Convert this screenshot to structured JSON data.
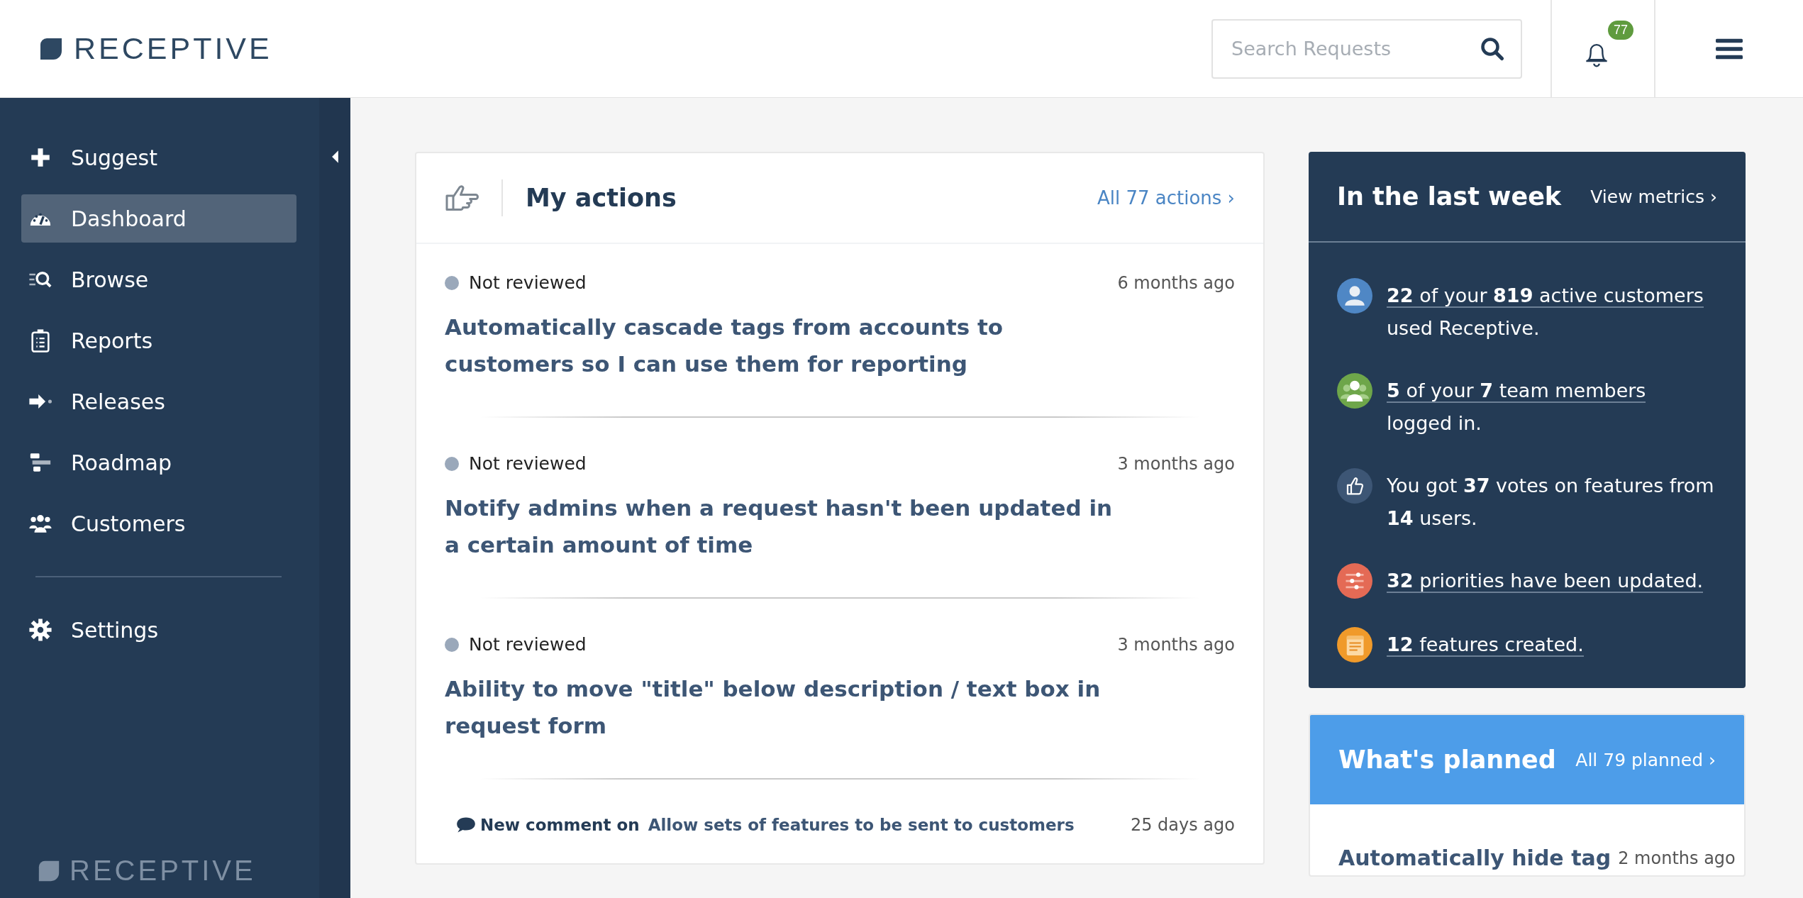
{
  "header": {
    "logo": "RECEPTIVE",
    "search": {
      "placeholder": "Search Requests"
    },
    "notifications": {
      "count": "77"
    }
  },
  "sidebar": {
    "items": [
      {
        "label": "Suggest",
        "selected": false
      },
      {
        "label": "Dashboard",
        "selected": true
      },
      {
        "label": "Browse",
        "selected": false
      },
      {
        "label": "Reports",
        "selected": false
      },
      {
        "label": "Releases",
        "selected": false
      },
      {
        "label": "Roadmap",
        "selected": false
      },
      {
        "label": "Customers",
        "selected": false
      }
    ],
    "bottom_items": [
      {
        "label": "Settings",
        "selected": false
      }
    ],
    "footer_logo": "RECEPTIVE"
  },
  "my_actions": {
    "title": "My actions",
    "link": "All 77 actions ›",
    "items": [
      {
        "kind": "request",
        "status": "Not reviewed",
        "time": "6 months ago",
        "title": "Automatically cascade tags from accounts to customers so I can use them for reporting"
      },
      {
        "kind": "request",
        "status": "Not reviewed",
        "time": "3 months ago",
        "title": "Notify admins when a request hasn't been updated in a certain amount of time"
      },
      {
        "kind": "request",
        "status": "Not reviewed",
        "time": "3 months ago",
        "title": "Ability to move \"title\" below description / text box in request form"
      },
      {
        "kind": "comment",
        "prefix": "New comment on",
        "link": "Allow sets of features to be sent to customers",
        "time": "25 days ago"
      }
    ]
  },
  "last_week": {
    "title": "In the last week",
    "link": "View metrics ›",
    "items": [
      {
        "kind": "customers",
        "link": "**22** of your **819** active customers",
        "text": "used Receptive."
      },
      {
        "kind": "team",
        "link": "**5** of your **7** team members",
        "text": "logged in."
      },
      {
        "kind": "votes",
        "text": "You got **37** votes on features from **14** users."
      },
      {
        "kind": "priorities",
        "link": "**32** priorities have been updated."
      },
      {
        "kind": "features",
        "link": "**12** features created."
      }
    ]
  },
  "planned": {
    "title": "What's planned",
    "link": "All 79 planned ›",
    "items": [
      {
        "title": "Automatically hide tag",
        "time": "2 months ago"
      }
    ]
  }
}
